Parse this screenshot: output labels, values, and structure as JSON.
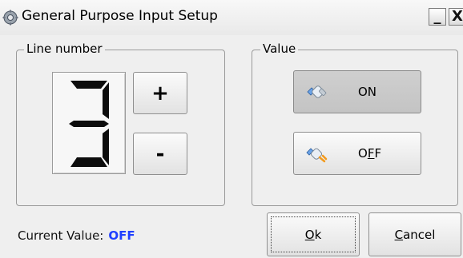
{
  "window": {
    "title": "General Purpose Input Setup",
    "minimize_symbol": "_",
    "close_symbol": "X",
    "icon": "gear-icon"
  },
  "line_group": {
    "label": "Line number",
    "digit": "3",
    "increment_label": "+",
    "decrement_label": "-"
  },
  "value_group": {
    "label": "Value",
    "on_button": {
      "label": "ON",
      "icon": "plug-connected-icon",
      "pressed": true
    },
    "off_button": {
      "pre": "O",
      "accel": "F",
      "post": "F",
      "icon": "plug-disconnected-icon",
      "pressed": false
    }
  },
  "status": {
    "label": "Current Value:",
    "value": "OFF",
    "value_color": "#1f3fff"
  },
  "footer": {
    "ok": {
      "accel": "O",
      "rest": "k"
    },
    "cancel": {
      "accel": "C",
      "rest": "ancel"
    }
  }
}
